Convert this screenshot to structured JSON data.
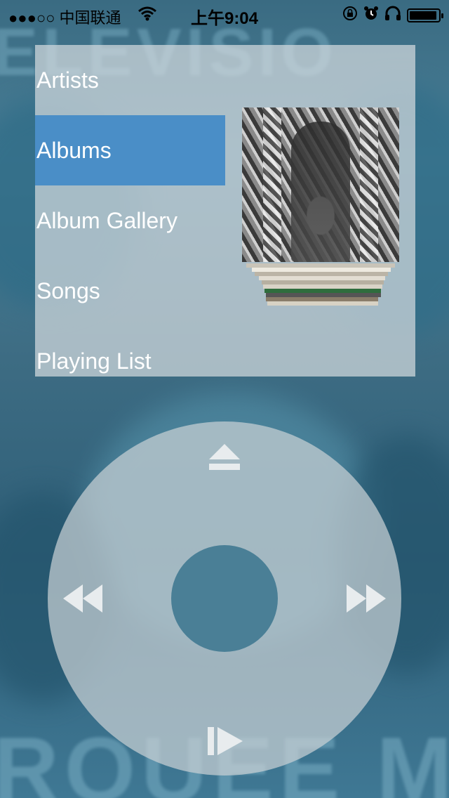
{
  "status_bar": {
    "carrier": "●●●○○ 中国联通",
    "time": "上午9:04",
    "battery_level": 0.95,
    "icons": [
      "wifi-icon",
      "orientation-lock-icon",
      "alarm-icon",
      "headphones-icon",
      "battery-icon"
    ]
  },
  "menu": {
    "items": [
      {
        "label": "Artists"
      },
      {
        "label": "Albums"
      },
      {
        "label": "Album Gallery"
      },
      {
        "label": "Songs"
      },
      {
        "label": "Playing List"
      }
    ],
    "selected_index": 1
  },
  "colors": {
    "selected": "#4a8ec7",
    "panel": "rgba(210,218,222,0.72)",
    "wheel": "rgba(200,208,212,0.72)",
    "center_button": "#4a7f96"
  },
  "wheel": {
    "top_icon": "eject-icon",
    "left_icon": "rewind-icon",
    "right_icon": "fast-forward-icon",
    "bottom_icon": "play-pause-icon"
  }
}
